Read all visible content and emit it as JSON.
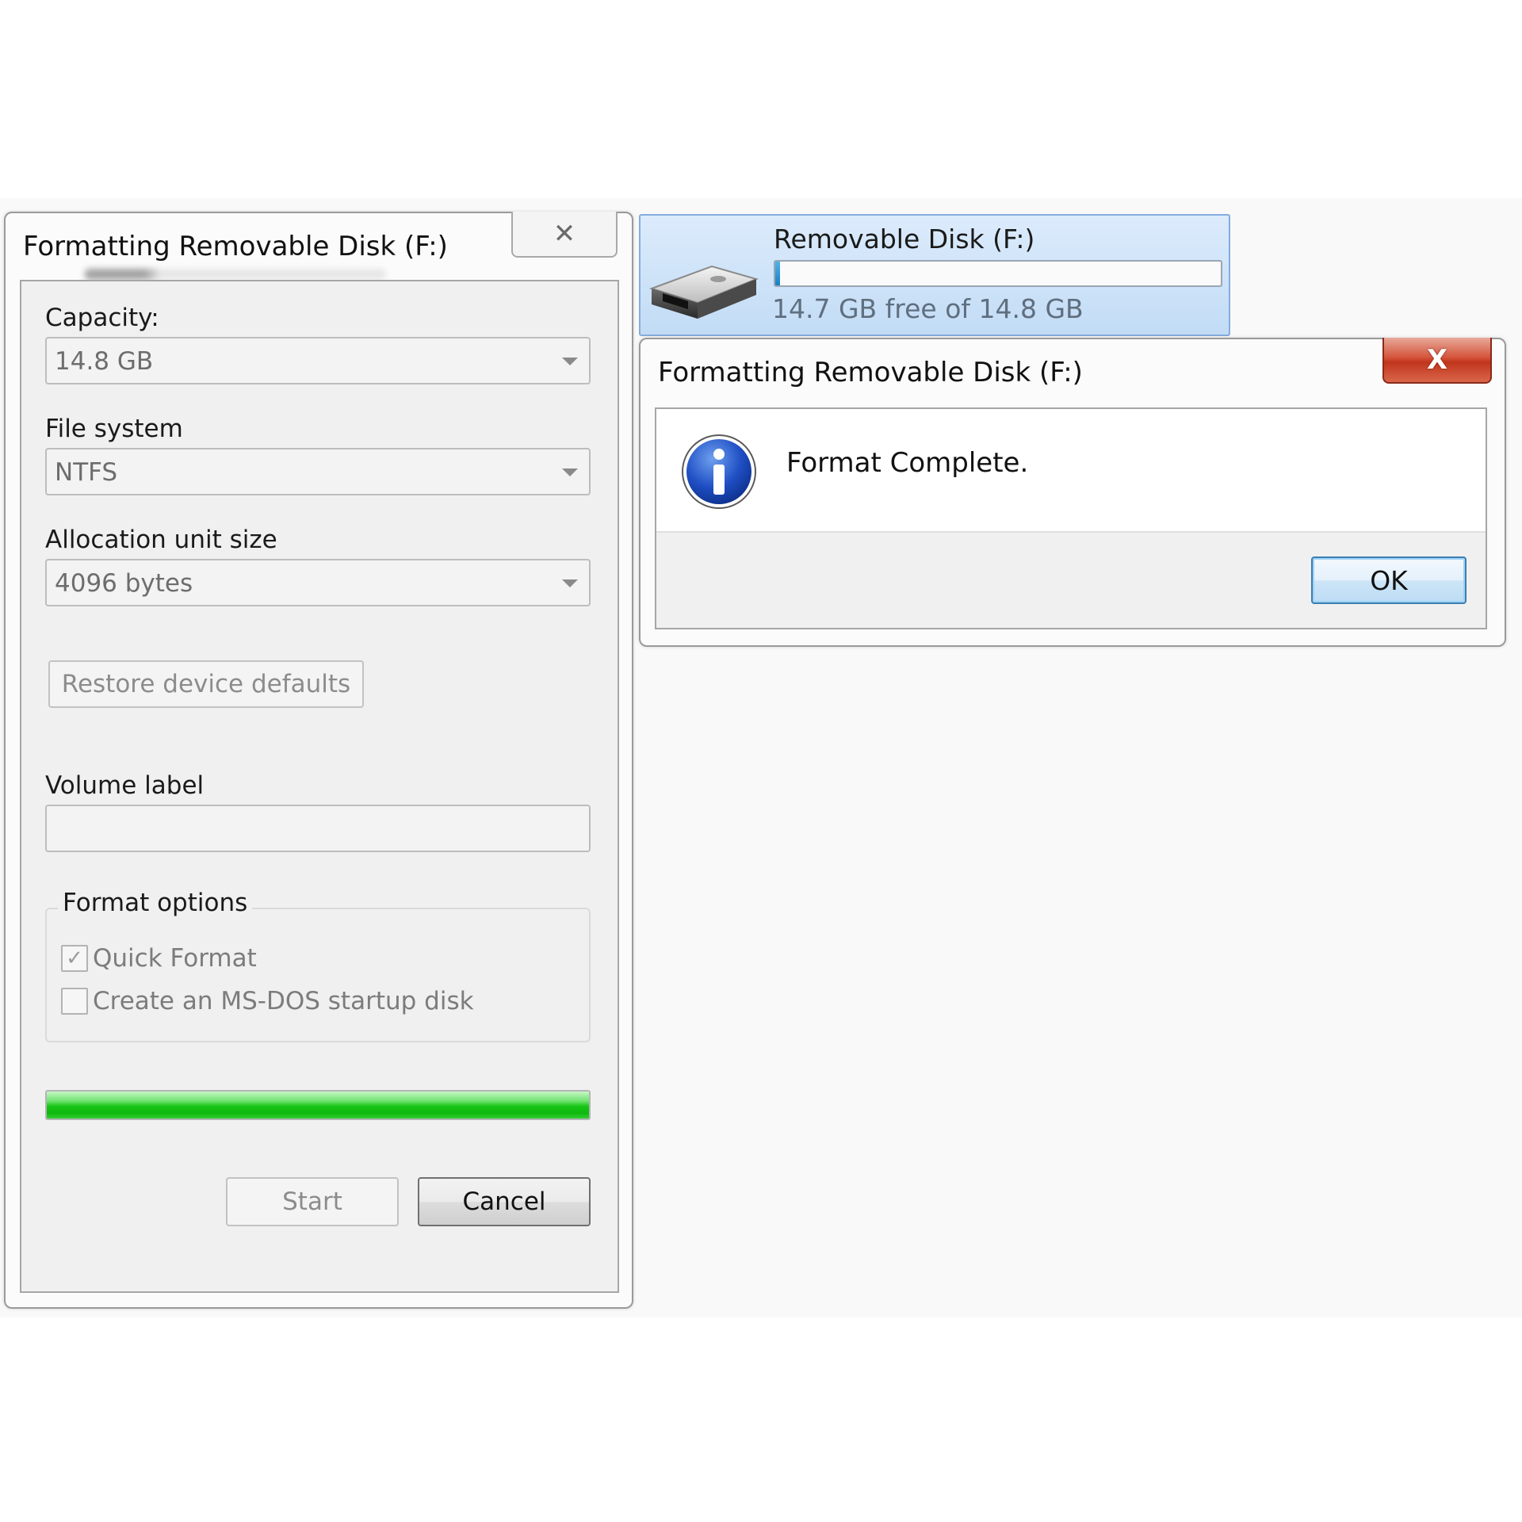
{
  "format_dialog": {
    "title": "Formatting Removable Disk (F:)",
    "close_glyph": "✕",
    "capacity_label": "Capacity:",
    "capacity_value": "14.8 GB",
    "filesystem_label": "File system",
    "filesystem_value": "NTFS",
    "allocation_label": "Allocation unit size",
    "allocation_value": "4096 bytes",
    "restore_button": "Restore device defaults",
    "volume_label_label": "Volume label",
    "volume_label_value": "",
    "format_options_label": "Format options",
    "quick_format_label": "Quick Format",
    "quick_format_checked": true,
    "msdos_label": "Create an MS-DOS startup disk",
    "msdos_checked": false,
    "progress_percent": 100,
    "progress_color": "#16c416",
    "start_button": "Start",
    "cancel_button": "Cancel"
  },
  "drive_tile": {
    "name": "Removable Disk (F:)",
    "free_text": "14.7 GB free of 14.8 GB",
    "used_percent": 1,
    "icon": "usb-drive-icon",
    "selection_color": "#c2dcf5"
  },
  "message_box": {
    "title": "Formatting Removable Disk (F:)",
    "close_glyph": "X",
    "icon": "info-icon",
    "message": "Format Complete.",
    "ok_button": "OK",
    "close_color": "#c0351c"
  }
}
